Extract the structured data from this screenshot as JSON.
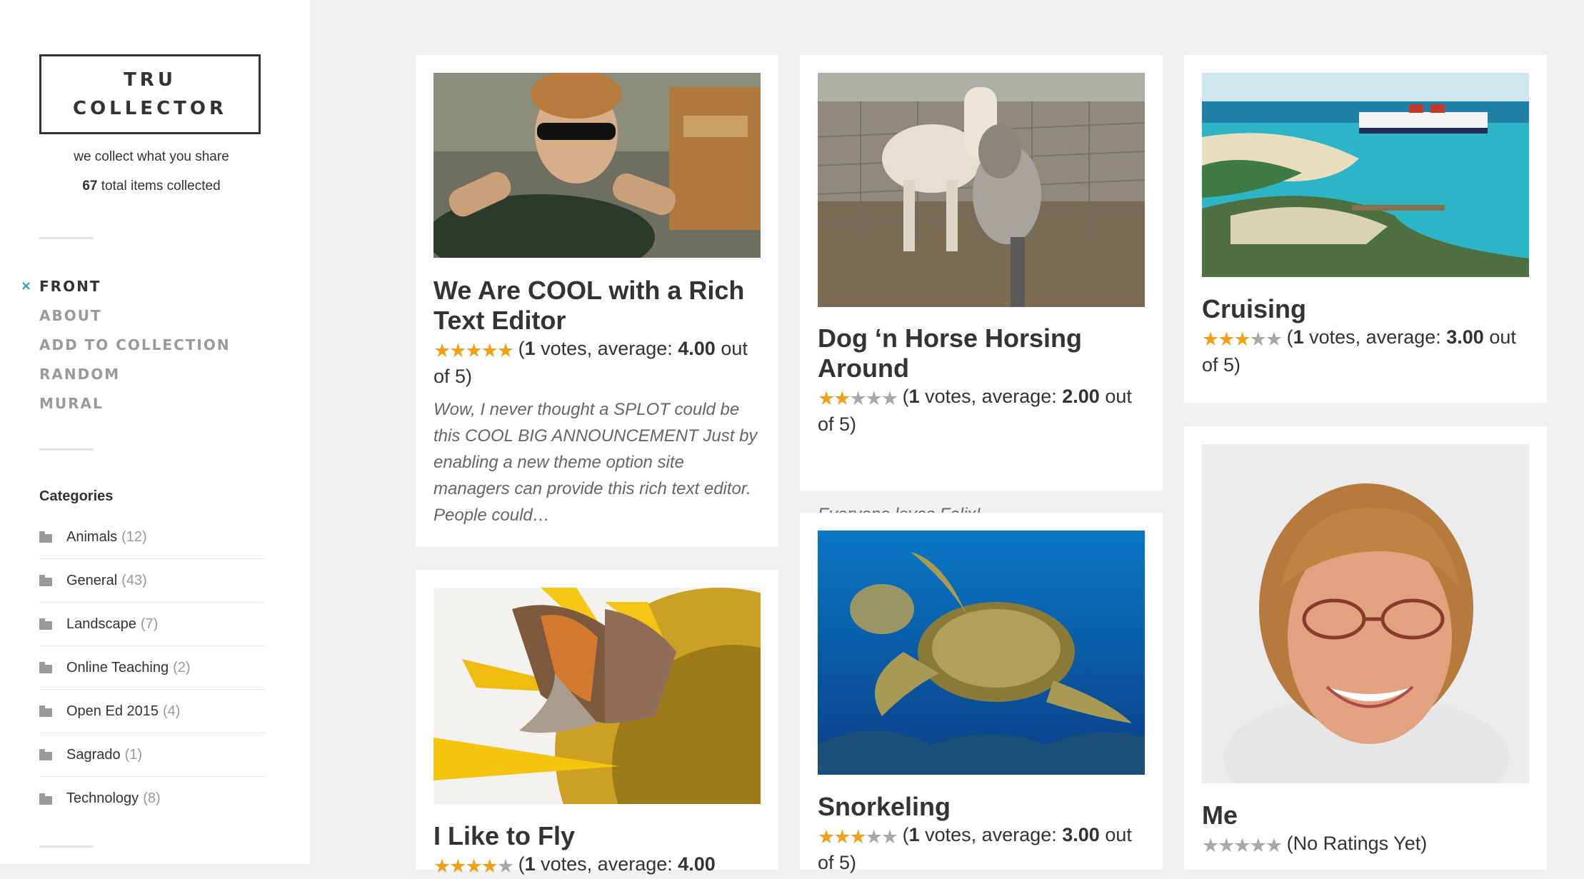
{
  "site": {
    "title_line1": "TRU",
    "title_line2": "COLLECTOR",
    "tagline": "we collect what you share",
    "total_count": "67",
    "total_label": "total items collected"
  },
  "nav": {
    "active_marker": "×",
    "items": [
      "FRONT",
      "ABOUT",
      "ADD TO COLLECTION",
      "RANDOM",
      "MURAL"
    ]
  },
  "categories": {
    "title": "Categories",
    "items": [
      {
        "name": "Animals",
        "count": "(12)"
      },
      {
        "name": "General",
        "count": "(43)"
      },
      {
        "name": "Landscape",
        "count": "(7)"
      },
      {
        "name": "Online Teaching",
        "count": "(2)"
      },
      {
        "name": "Open Ed 2015",
        "count": "(4)"
      },
      {
        "name": "Sagrado",
        "count": "(1)"
      },
      {
        "name": "Technology",
        "count": "(8)"
      }
    ]
  },
  "accent_color": "#21a0b5",
  "star_color": "#f2a019",
  "cards": [
    {
      "title": "We Are COOL with a Rich Text Editor",
      "stars_filled": 5,
      "rating_pre": "(",
      "votes": "1",
      "rating_mid": " votes, average: ",
      "average": "4.00",
      "rating_post": " out of 5)",
      "excerpt": "Wow, I never thought a SPLOT could be this COOL BIG ANNOUNCEMENT Just by enabling a new theme option site managers can provide this rich text editor. People could…",
      "image": "teen with sunglasses"
    },
    {
      "title": "Dog ‘n Horse Horsing Around",
      "stars_filled": 2,
      "rating_pre": "(",
      "votes": "1",
      "rating_mid": " votes, average: ",
      "average": "2.00",
      "rating_post": " out of 5)",
      "excerpt": "Everyone loves Felix!",
      "image": "horse and dog at fence"
    },
    {
      "title": "Cruising",
      "stars_filled": 3,
      "rating_pre": "(",
      "votes": "1",
      "rating_mid": " votes, average: ",
      "average": "3.00",
      "rating_post": " out of 5)",
      "image": "cruise ship island"
    },
    {
      "title": "I Like to Fly",
      "stars_filled": 4,
      "rating_pre": "(",
      "votes": "1",
      "rating_mid": " votes, average: ",
      "average": "4.00",
      "rating_post": "",
      "image": "butterfly on sunflower"
    },
    {
      "title": "Snorkeling",
      "stars_filled": 3,
      "rating_pre": "(",
      "votes": "1",
      "rating_mid": " votes, average: ",
      "average": "3.00",
      "rating_post": " out of 5)",
      "image": "sea turtle underwater"
    },
    {
      "title": "Me",
      "stars_filled": 0,
      "rating_text": "(No Ratings Yet)",
      "image": "smiling woman portrait"
    }
  ]
}
